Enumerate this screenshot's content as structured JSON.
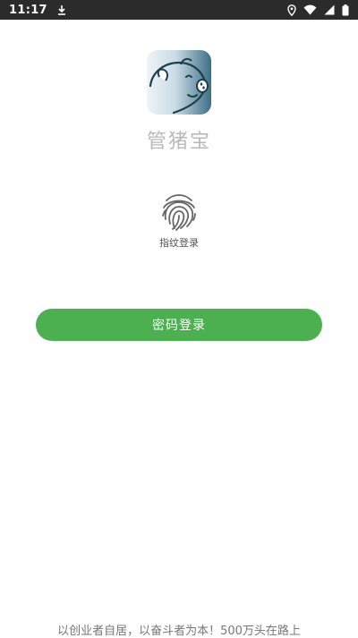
{
  "status_bar": {
    "time": "11:17",
    "icons": [
      "download-icon",
      "location-icon",
      "wifi-icon",
      "signal-icon",
      "battery-icon"
    ]
  },
  "app": {
    "name": "管猪宝",
    "logo": "pig-logo-icon",
    "logo_colors": [
      "#eef4f8",
      "#3e6f85"
    ]
  },
  "fingerprint": {
    "label": "指纹登录",
    "icon": "fingerprint-icon"
  },
  "password_login": {
    "label": "密码登录",
    "color": "#4caf50"
  },
  "footer": {
    "slogan": "以创业者自居，以奋斗者为本！500万头在路上"
  }
}
